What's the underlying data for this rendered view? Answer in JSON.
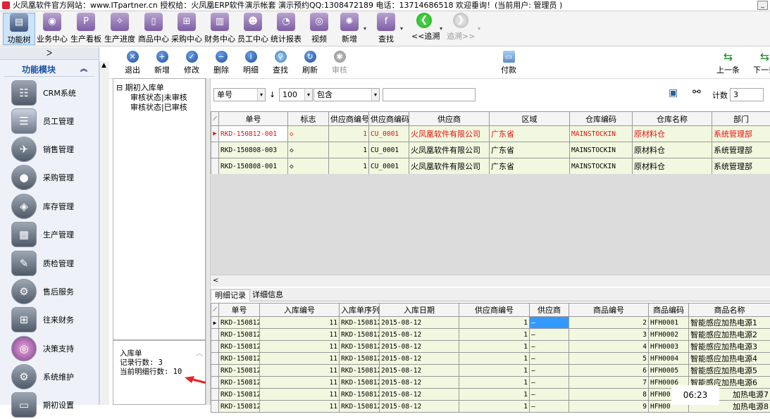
{
  "title_bar": {
    "text": "火凤凰软件官方网站：www.ITpartner.cn  授权给：火凤凰ERP软件演示帐套 演示预约QQ:1308472189  电话：13714686518  欢迎垂询！(当前用户: 管理员 )",
    "window_button": "_"
  },
  "toolbar": {
    "items": [
      "功能树",
      "业务中心",
      "生产看板",
      "生产进度",
      "商品中心",
      "采购中心",
      "财务中心",
      "员工中心",
      "统计报表",
      "视频",
      "新增",
      "查找",
      "<<追溯",
      "追溯>>"
    ]
  },
  "sidebar": {
    "top_label": "ᐳ",
    "header": "功能模块",
    "header_chevron": "︽",
    "items": [
      "CRM系统",
      "员工管理",
      "销售管理",
      "采购管理",
      "库存管理",
      "生产管理",
      "质检管理",
      "售后服务",
      "往来财务",
      "决策支持",
      "系统维护",
      "期初设置"
    ]
  },
  "actions": {
    "left": [
      "退出",
      "新增",
      "修改",
      "删除",
      "明细",
      "查找",
      "刷新",
      "审核"
    ],
    "payment": "付款",
    "prev": "上一条",
    "next": "下一条"
  },
  "tree": {
    "root": "期初入库单",
    "children": [
      "审核状态|未审核",
      "审核状态|已审核"
    ]
  },
  "info": {
    "line1": "入库单",
    "line2": "记录行数: 3",
    "line3": "当前明细行数: 10"
  },
  "filter": {
    "field": "单号",
    "sort": "↓",
    "limit": "100",
    "operator": "包含",
    "value": "",
    "count_label": "计数",
    "count_value": "3"
  },
  "grid1": {
    "columns": [
      "单号",
      "标志",
      "供应商编号",
      "供应商编码",
      "供应商",
      "区域",
      "仓库编码",
      "仓库名称",
      "部门"
    ],
    "rows": [
      [
        "RKD-150812-001",
        "◇",
        "1",
        "CU_0001",
        "火凤凰软件有限公司",
        "广东省",
        "MAINSTOCKIN",
        "原材料仓",
        "系统管理部"
      ],
      [
        "RKD-150808-003",
        "◇",
        "1",
        "CU_0001",
        "火凤凰软件有限公司",
        "广东省",
        "MAINSTOCKIN",
        "原材料仓",
        "系统管理部"
      ],
      [
        "RKD-150808-001",
        "◇",
        "1",
        "CU_0001",
        "火凤凰软件有限公司",
        "广东省",
        "MAINSTOCKIN",
        "原材料仓",
        "系统管理部"
      ]
    ],
    "scroll_arrow": "<"
  },
  "tabs": [
    "明细记录",
    "详细信息"
  ],
  "grid2": {
    "columns": [
      "单号",
      "入库编号",
      "入库单序列",
      "入库日期",
      "供应商编号",
      "供应商",
      "商品编号",
      "商品编码",
      "商品名称"
    ],
    "rows": [
      [
        "RKD-150812-",
        "11",
        "RKD-150812-",
        "2015-08-12",
        "1",
        "–",
        "2",
        "HFH0001",
        "智能感应加热电源1"
      ],
      [
        "RKD-150812-",
        "11",
        "RKD-150812-",
        "2015-08-12",
        "1",
        "–",
        "3",
        "HFH0002",
        "智能感应加热电源2"
      ],
      [
        "RKD-150812-",
        "11",
        "RKD-150812-",
        "2015-08-12",
        "1",
        "–",
        "4",
        "HFH0003",
        "智能感应加热电源3"
      ],
      [
        "RKD-150812-",
        "11",
        "RKD-150812-",
        "2015-08-12",
        "1",
        "–",
        "5",
        "HFH0004",
        "智能感应加热电源4"
      ],
      [
        "RKD-150812-",
        "11",
        "RKD-150812-",
        "2015-08-12",
        "1",
        "–",
        "6",
        "HFH0005",
        "智能感应加热电源5"
      ],
      [
        "RKD-150812-",
        "11",
        "RKD-150812-",
        "2015-08-12",
        "1",
        "–",
        "7",
        "HFH0006",
        "智能感应加热电源6"
      ],
      [
        "RKD-150812-",
        "11",
        "RKD-150812-",
        "2015-08-12",
        "1",
        "–",
        "8",
        "HFH00",
        "加热电源7"
      ],
      [
        "RKD-150812-",
        "11",
        "RKD-150812-",
        "2015-08-12",
        "1",
        "–",
        "9",
        "HFH00",
        "加热电源8"
      ]
    ]
  },
  "clock": "06:23"
}
